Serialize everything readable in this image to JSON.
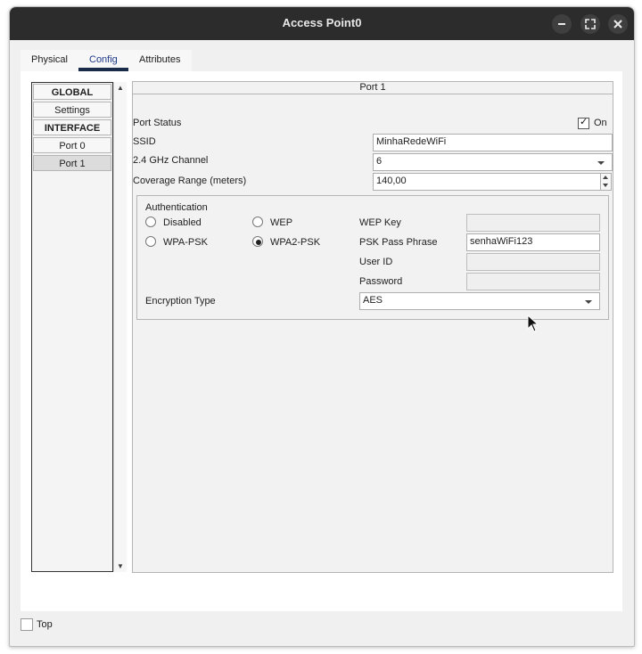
{
  "window": {
    "title": "Access Point0"
  },
  "tabs": [
    "Physical",
    "Config",
    "Attributes"
  ],
  "sidebar": {
    "global_header": "GLOBAL",
    "settings": "Settings",
    "interface_header": "INTERFACE",
    "port0": "Port 0",
    "port1": "Port 1"
  },
  "panel": {
    "title": "Port 1",
    "port_status_label": "Port Status",
    "port_status_on": "On",
    "ssid_label": "SSID",
    "ssid_value": "MinhaRedeWiFi",
    "channel_label": "2.4 GHz Channel",
    "channel_value": "6",
    "coverage_label": "Coverage Range (meters)",
    "coverage_value": "140,00",
    "auth": {
      "title": "Authentication",
      "disabled": "Disabled",
      "wep": "WEP",
      "wpa_psk": "WPA-PSK",
      "wpa2_psk": "WPA2-PSK",
      "wep_key_label": "WEP Key",
      "psk_label": "PSK Pass Phrase",
      "psk_value": "senhaWiFi123",
      "user_id_label": "User ID",
      "password_label": "Password",
      "encryption_label": "Encryption Type",
      "encryption_value": "AES"
    }
  },
  "bottom": {
    "top_label": "Top"
  }
}
